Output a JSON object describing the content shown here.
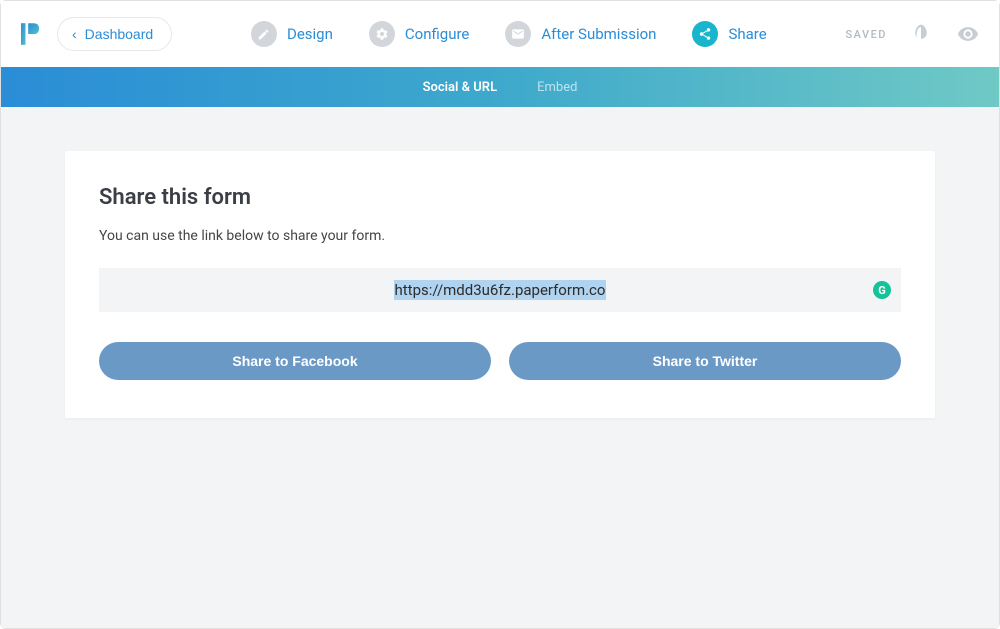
{
  "header": {
    "back_label": "Dashboard",
    "tabs": [
      {
        "label": "Design",
        "icon": "pencil-icon"
      },
      {
        "label": "Configure",
        "icon": "gear-icon"
      },
      {
        "label": "After Submission",
        "icon": "mail-icon"
      },
      {
        "label": "Share",
        "icon": "share-icon"
      }
    ],
    "saved_label": "SAVED"
  },
  "sub_nav": {
    "items": [
      {
        "label": "Social & URL",
        "active": true
      },
      {
        "label": "Embed",
        "active": false
      }
    ]
  },
  "share": {
    "title": "Share this form",
    "subtitle": "You can use the link below to share your form.",
    "url": "https://mdd3u6fz.paperform.co",
    "facebook_label": "Share to Facebook",
    "twitter_label": "Share to Twitter"
  }
}
